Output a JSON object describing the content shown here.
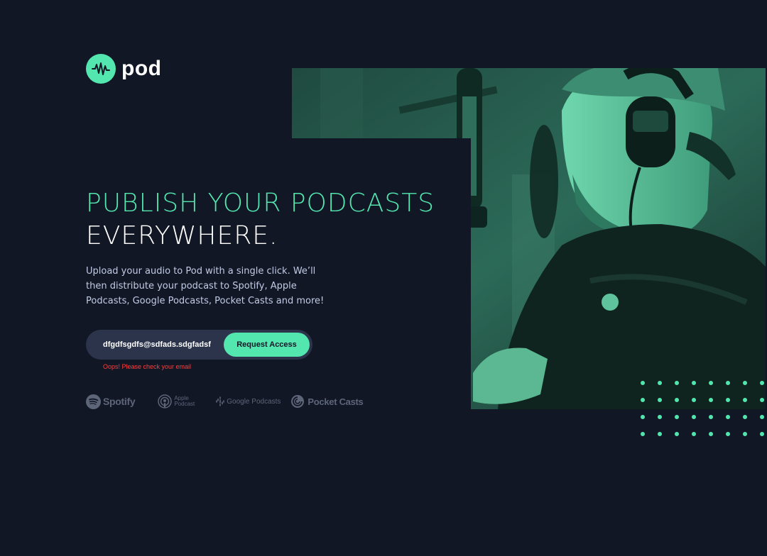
{
  "brand": {
    "name": "pod",
    "accent_color": "#54e6af",
    "background_color": "#121725",
    "icon": "waveform-icon"
  },
  "hero": {
    "headline_accent": "PUBLISH YOUR PODCASTS",
    "headline_plain": "EVERYWHERE.",
    "description": "Upload your audio to Pod with a single click. We’ll then distribute your podcast to Spotify, Apple Podcasts, Google Podcasts, Pocket Casts and more!"
  },
  "form": {
    "email_value": "dfgdfsgdfs@sdfads.sdgfadsf",
    "submit_label": "Request Access",
    "error_message": "Oops! Please check your email",
    "error_color": "#fb3e3e"
  },
  "platforms": {
    "spotify": "Spotify",
    "apple_line1": "Apple",
    "apple_line2": "Podcast",
    "google": "Google Podcasts",
    "pocket": "Pocket Casts"
  },
  "image": {
    "icon": "podcaster-photo",
    "tint": "#54e6af"
  }
}
